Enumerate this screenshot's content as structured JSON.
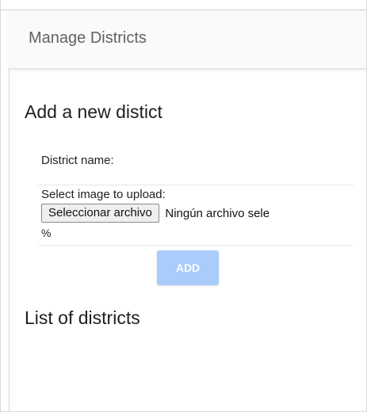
{
  "header": {
    "title": "Manage Districts"
  },
  "add_section": {
    "title": "Add a new distict",
    "district_name_label": "District name:",
    "upload_label": "Select image to upload:",
    "file_button_label": "Seleccionar archivo",
    "file_status": "Ningún archivo sele",
    "progress_text": "%",
    "add_button_label": "ADD",
    "add_button_color": "#a9ccfb"
  },
  "list_section": {
    "title": "List of districts"
  }
}
